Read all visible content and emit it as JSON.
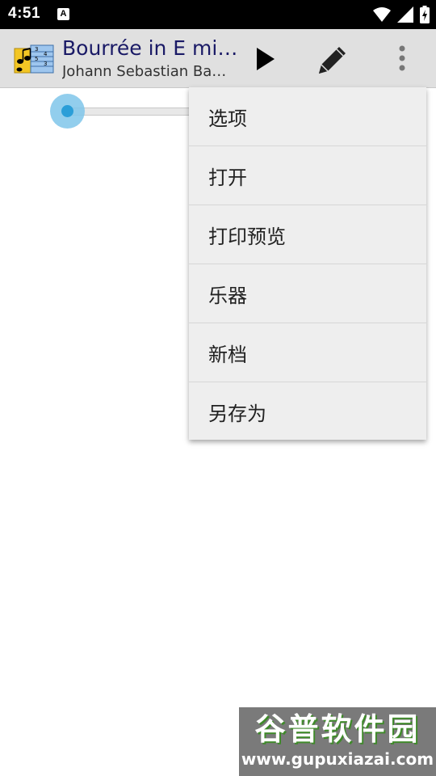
{
  "status_bar": {
    "time": "4:51",
    "notification_badge": "A",
    "icons": [
      "wifi-icon",
      "signal-icon",
      "battery-charging-icon"
    ]
  },
  "app_bar": {
    "title": "Bourrée in E mi…",
    "subtitle": "Johann Sebastian Ba…",
    "icons": [
      "app-logo-icon",
      "play-icon",
      "pencil-icon",
      "more-vert-icon"
    ]
  },
  "slider": {
    "position_fraction": 0.0,
    "accent_color": "#2b9ed8"
  },
  "menu": {
    "items": [
      {
        "label": "选项"
      },
      {
        "label": "打开"
      },
      {
        "label": "打印预览"
      },
      {
        "label": "乐器"
      },
      {
        "label": "新档"
      },
      {
        "label": "另存为"
      }
    ]
  },
  "watermark": {
    "title": "谷普软件园",
    "url": "www.gupuxiazai.com"
  },
  "colors": {
    "app_bar_bg": "#e0e0e0",
    "title_color": "#1a1a66",
    "menu_bg": "#eeeeee"
  }
}
